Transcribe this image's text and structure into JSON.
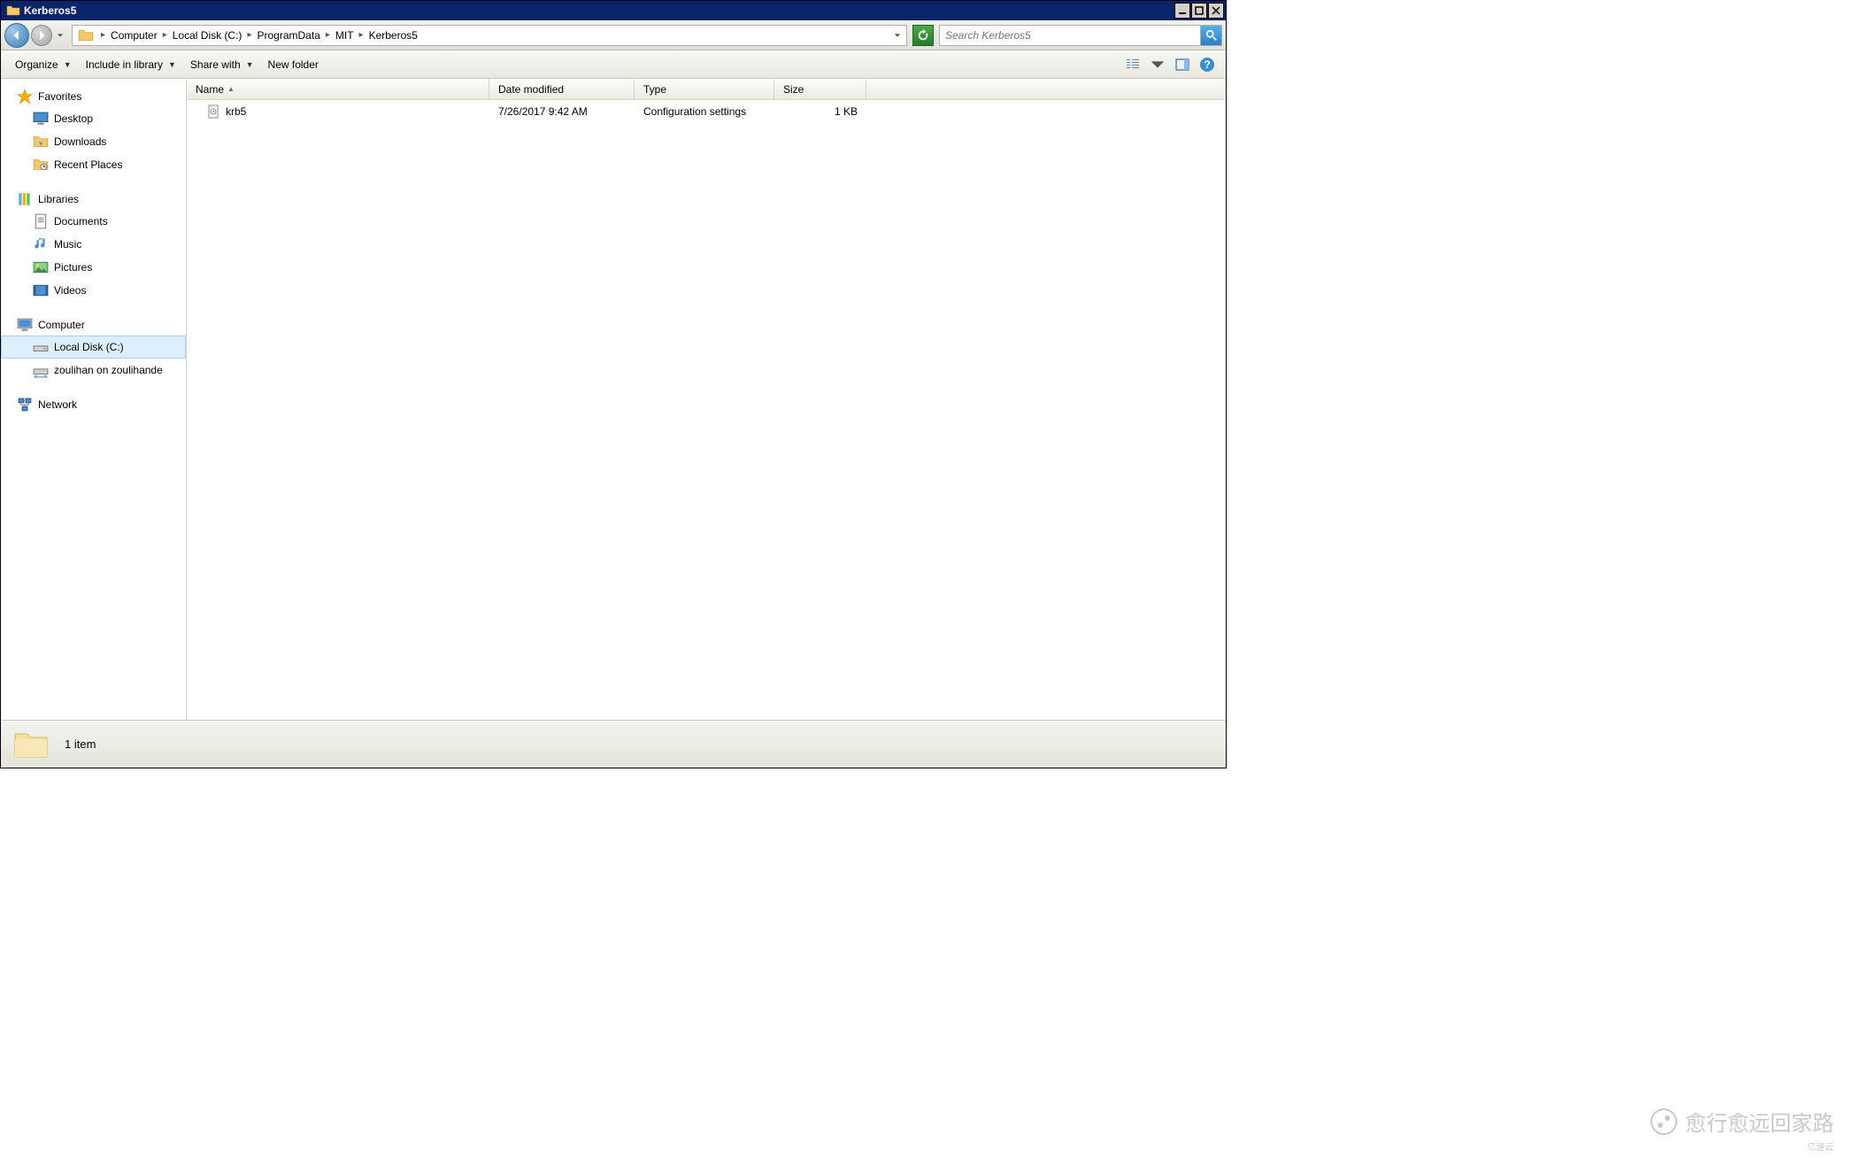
{
  "window": {
    "title": "Kerberos5"
  },
  "breadcrumb": {
    "items": [
      "Computer",
      "Local Disk (C:)",
      "ProgramData",
      "MIT",
      "Kerberos5"
    ]
  },
  "search": {
    "placeholder": "Search Kerberos5"
  },
  "toolbar": {
    "organize": "Organize",
    "include": "Include in library",
    "share": "Share with",
    "newfolder": "New folder"
  },
  "sidebar": {
    "favorites": {
      "label": "Favorites",
      "items": [
        "Desktop",
        "Downloads",
        "Recent Places"
      ]
    },
    "libraries": {
      "label": "Libraries",
      "items": [
        "Documents",
        "Music",
        "Pictures",
        "Videos"
      ]
    },
    "computer": {
      "label": "Computer",
      "items": [
        "Local Disk (C:)",
        "zoulihan on zoulihande"
      ]
    },
    "network": {
      "label": "Network"
    }
  },
  "columns": {
    "name": "Name",
    "date": "Date modified",
    "type": "Type",
    "size": "Size"
  },
  "files": {
    "rows": [
      {
        "name": "krb5",
        "date": "7/26/2017 9:42 AM",
        "type": "Configuration settings",
        "size": "1 KB"
      }
    ]
  },
  "status": {
    "text": "1 item"
  },
  "watermark": {
    "text": "愈行愈远回家路",
    "small": "亿速云"
  }
}
